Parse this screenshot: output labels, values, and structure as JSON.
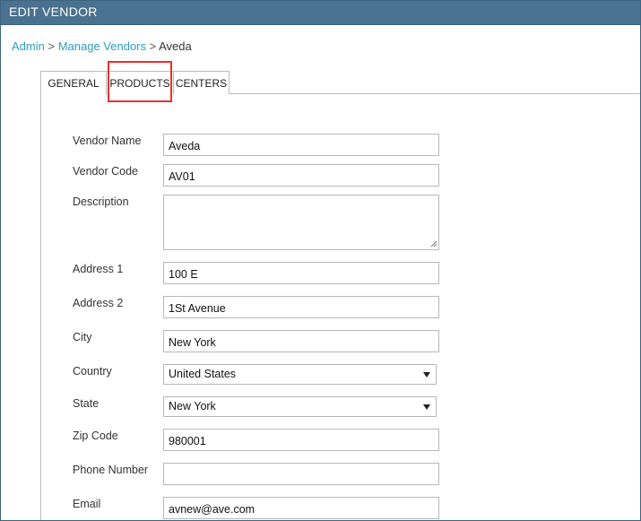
{
  "window": {
    "title": "EDIT VENDOR"
  },
  "breadcrumb": {
    "admin": "Admin",
    "sep": ">",
    "manage": "Manage Vendors",
    "current": "Aveda"
  },
  "tabs": [
    {
      "label": "GENERAL",
      "active": true
    },
    {
      "label": "PRODUCTS",
      "active": false,
      "highlighted": true
    },
    {
      "label": "CENTERS",
      "active": false
    }
  ],
  "form": {
    "vendor_name": {
      "label": "Vendor Name",
      "value": "Aveda"
    },
    "vendor_code": {
      "label": "Vendor Code",
      "value": "AV01"
    },
    "description": {
      "label": "Description",
      "value": ""
    },
    "address1": {
      "label": "Address 1",
      "value": "100 E"
    },
    "address2": {
      "label": "Address 2",
      "value": "1St Avenue"
    },
    "city": {
      "label": "City",
      "value": "New York"
    },
    "country": {
      "label": "Country",
      "value": "United States"
    },
    "state": {
      "label": "State",
      "value": "New York"
    },
    "zip": {
      "label": "Zip Code",
      "value": "980001"
    },
    "phone": {
      "label": "Phone Number",
      "value": ""
    },
    "email": {
      "label": "Email",
      "value": "avnew@ave.com"
    }
  },
  "colors": {
    "titlebar": "#4a7290",
    "link": "#2a9fbf",
    "highlight": "#e5312f"
  }
}
